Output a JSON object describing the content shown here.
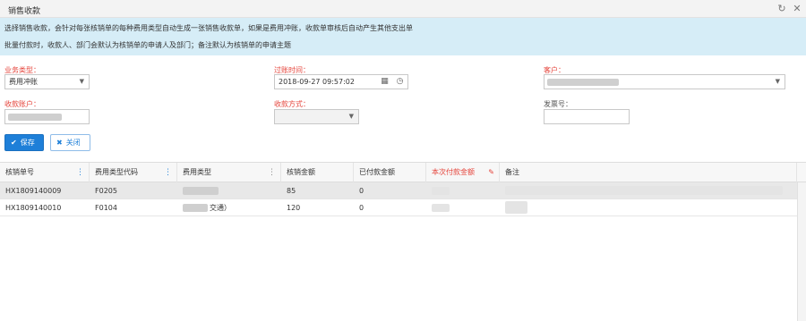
{
  "window": {
    "title": "销售收款",
    "refresh_icon": "refresh-icon",
    "close_icon": "close-icon"
  },
  "notice": {
    "line1": "选择销售收款，会针对每张核销单的每种费用类型自动生成一张销售收款单，如果是费用冲账，收款单审核后自动产生其他支出单",
    "line2": "批量付款时，收款人、部门会默认为核销单的申请人及部门；备注默认为核销单的申请主题"
  },
  "form": {
    "business_type": {
      "label": "业务类型：",
      "value": "费用冲账"
    },
    "posting_time": {
      "label": "过账时间：",
      "value": "2018-09-27 09:57:02"
    },
    "customer": {
      "label": "客户：",
      "value": ""
    },
    "receive_account": {
      "label": "收款账户：",
      "value": ""
    },
    "receive_method": {
      "label": "收款方式：",
      "value": ""
    },
    "invoice_no": {
      "label": "发票号：",
      "value": ""
    }
  },
  "buttons": {
    "save": "保存",
    "close": "关闭"
  },
  "table": {
    "columns": [
      "核销单号",
      "费用类型代码",
      "费用类型",
      "核销金额",
      "已付款金额",
      "本次付款金额",
      "备注"
    ],
    "rows": [
      {
        "order_no": "HX1809140009",
        "type_code": "F0205",
        "type_name": "",
        "amount": "85",
        "paid": "0",
        "current": "",
        "remark": ""
      },
      {
        "order_no": "HX1809140010",
        "type_code": "F0104",
        "type_name": "交通）",
        "amount": "120",
        "paid": "0",
        "current": "",
        "remark": ""
      }
    ]
  },
  "colors": {
    "accent": "#1e7fd8",
    "required": "#e5443b",
    "notice_bg": "#d6edf7"
  }
}
